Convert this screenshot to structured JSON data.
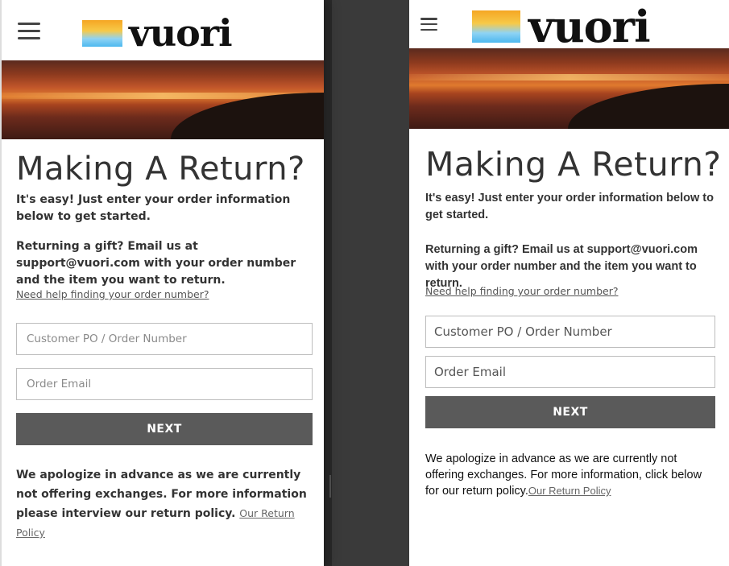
{
  "brand": {
    "name": "vuori"
  },
  "left": {
    "title": "Making A Return?",
    "intro": "It's easy! Just enter your order information below to get started.",
    "gift": "Returning a gift? Email us at support@vuori.com with your order number and the item you want to return.",
    "help_link": "Need help finding your order number?",
    "order_placeholder": "Customer PO / Order Number",
    "email_placeholder": "Order Email",
    "next_label": "NEXT",
    "note": "We apologize in advance as we are currently not offering exchanges. For more information please interview our return policy.",
    "policy_link": "Our Return Policy"
  },
  "right": {
    "title": "Making A Return?",
    "intro": "It's easy! Just enter your order information below to get started.",
    "gift": "Returning a gift? Email us at support@vuori.com with your order number and the item you want to return.",
    "help_link": "Need help finding your order number?",
    "order_placeholder": "Customer PO / Order Number",
    "email_placeholder": "Order Email",
    "next_label": "NEXT",
    "note": "We apologize in advance as we are currently not offering exchanges. For more information, click below for our return policy.",
    "policy_link": "Our Return Policy"
  },
  "colors": {
    "button": "#5a5a5a",
    "text": "#333333",
    "border": "#bdbdbd"
  },
  "icons": {
    "menu": "hamburger-menu-icon"
  }
}
